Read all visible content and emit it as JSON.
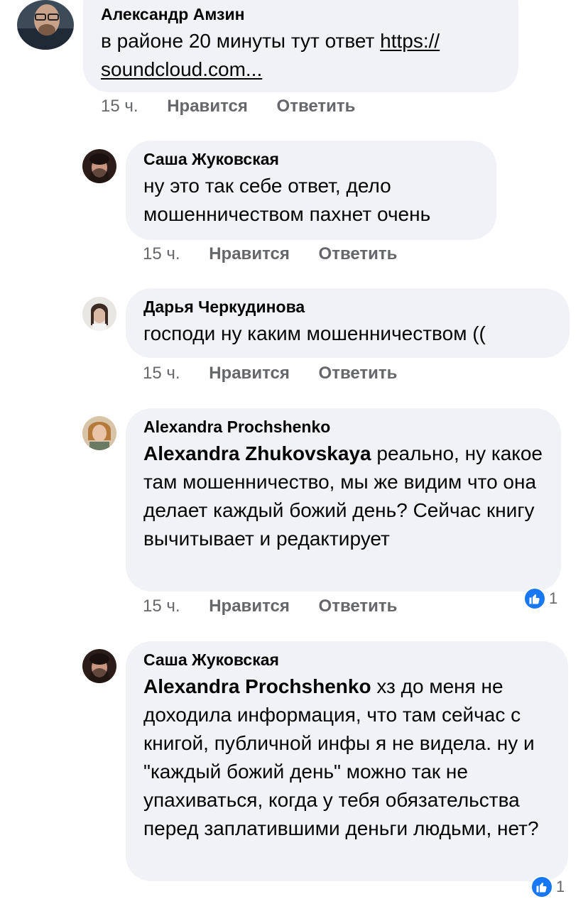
{
  "comments": [
    {
      "author": "Александр Амзин",
      "text": "в районе 20 минуты тут ответ ",
      "link": "https:// soundcloud.com...",
      "time": "15 ч.",
      "like": "Нравится",
      "reply": "Ответить"
    },
    {
      "author": "Саша Жуковская",
      "text": "ну это так себе ответ, дело мошенничеством пахнет очень",
      "time": "15 ч.",
      "like": "Нравится",
      "reply": "Ответить"
    },
    {
      "author": "Дарья Черкудинова",
      "text": "господи ну каким мошенничеством ((",
      "time": "15 ч.",
      "like": "Нравится",
      "reply": "Ответить"
    },
    {
      "author": "Alexandra Prochshenko",
      "mention": "Alexandra Zhukovskaya",
      "text": " реально, ну какое там мошенничество, мы же видим что она делает каждый божий день? Сейчас книгу вычитывает и редактирует",
      "time": "15 ч.",
      "like": "Нравится",
      "reply": "Ответить",
      "reactions": "1"
    },
    {
      "author": "Саша Жуковская",
      "mention": "Alexandra Prochshenko",
      "text": " хз до меня не доходила информация, что там сейчас с книгой, публичной инфы я не видела. ну и \"каждый божий день\" можно так не упахиваться, когда у тебя обязательства перед заплатившими деньги людьми, нет?",
      "reactions": "1"
    }
  ],
  "colors": {
    "bubble": "#f0f2f5",
    "meta": "#65676b",
    "like_blue": "#1877f2"
  },
  "icons": {
    "reaction": "thumbs-up-icon"
  }
}
